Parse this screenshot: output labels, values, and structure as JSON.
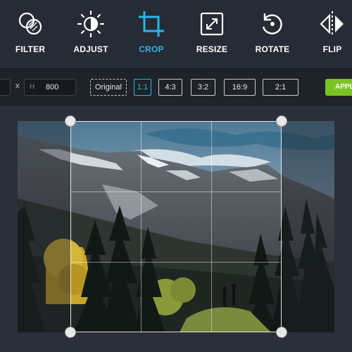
{
  "toolbar": {
    "tools": [
      {
        "label": "FILTER",
        "icon": "filter-icon"
      },
      {
        "label": "ADJUST",
        "icon": "adjust-icon"
      },
      {
        "label": "CROP",
        "icon": "crop-icon",
        "active": true
      },
      {
        "label": "RESIZE",
        "icon": "resize-icon"
      },
      {
        "label": "ROTATE",
        "icon": "rotate-icon"
      },
      {
        "label": "FLIP",
        "icon": "flip-icon"
      }
    ],
    "active_color": "#29b6e8"
  },
  "options": {
    "size_separator": "x",
    "height_prefix": "H",
    "height_value": "800",
    "ratios": [
      "Original",
      "1:1",
      "4:3",
      "3:2",
      "16:9",
      "2:1"
    ],
    "selected_ratio": "1:1",
    "apply_label": "APPLY",
    "apply_color": "#7cc223"
  }
}
